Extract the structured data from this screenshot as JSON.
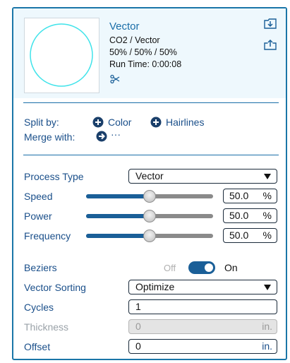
{
  "header": {
    "title": "Vector",
    "laser_source": "CO2 / Vector",
    "power_levels": "50% / 50% / 50%",
    "run_time": "Run Time: 0:00:08",
    "icons": [
      "scissors-icon",
      "import-icon",
      "export-icon"
    ]
  },
  "split": {
    "label": "Split by:",
    "color_label": "Color",
    "hairlines_label": "Hairlines"
  },
  "merge": {
    "label": "Merge with:",
    "more_label": "···"
  },
  "process_type": {
    "label": "Process Type",
    "value": "Vector"
  },
  "speed": {
    "label": "Speed",
    "value": "50.0",
    "unit": "%",
    "level": 0.5
  },
  "power": {
    "label": "Power",
    "value": "50.0",
    "unit": "%",
    "level": 0.5
  },
  "frequency": {
    "label": "Frequency",
    "value": "50.0",
    "unit": "%",
    "level": 0.5
  },
  "beziers": {
    "label": "Beziers",
    "off_label": "Off",
    "on_label": "On",
    "enabled": true
  },
  "vector_sorting": {
    "label": "Vector Sorting",
    "value": "Optimize"
  },
  "cycles": {
    "label": "Cycles",
    "value": "1"
  },
  "thickness": {
    "label": "Thickness",
    "value": "0",
    "unit": "in."
  },
  "offset": {
    "label": "Offset",
    "value": "0",
    "unit": "in."
  },
  "colors": {
    "accent": "#1a5f98",
    "header_bg": "#eef8fd",
    "preview_stroke": "#3fe3ea"
  }
}
